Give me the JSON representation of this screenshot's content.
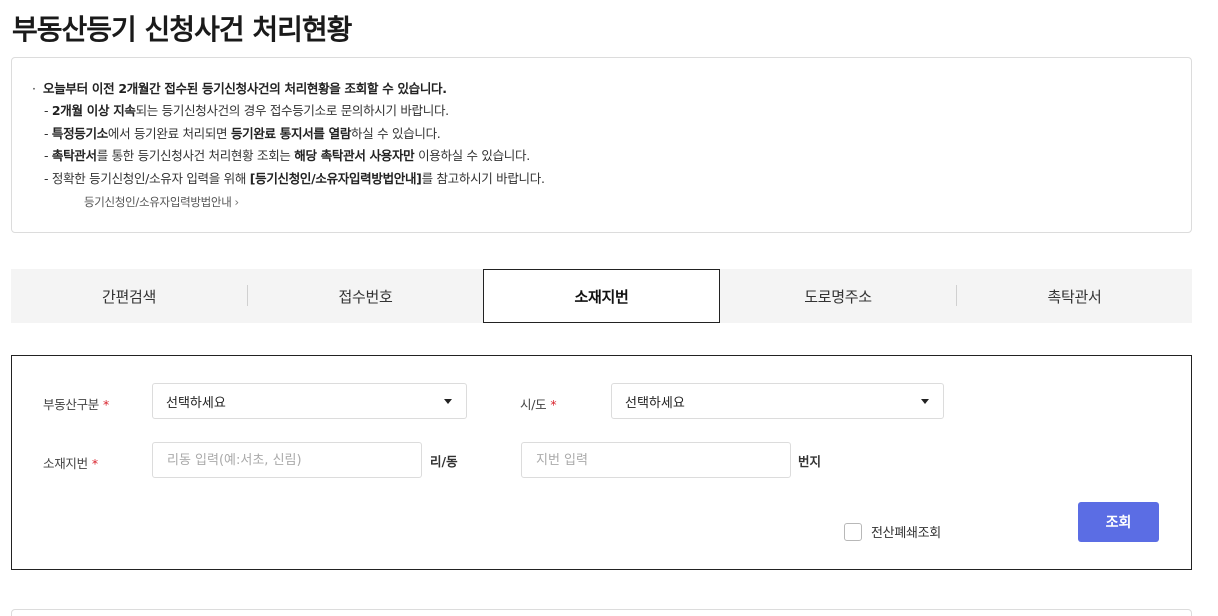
{
  "page": {
    "title": "부동산등기 신청사건 처리현황"
  },
  "notice": {
    "line1_bold": "오늘부터 이전 2개월간 접수된 등기신청사건의 처리현황을 조회할 수 있습니다.",
    "line2_bold": "2개월 이상 지속",
    "line2_rest": "되는 등기신청사건의 경우 접수등기소로 문의하시기 바랍니다.",
    "line3_bold1": "특정등기소",
    "line3_mid": "에서 등기완료 처리되면 ",
    "line3_bold2": "등기완료 통지서를 열람",
    "line3_rest": "하실 수 있습니다.",
    "line4_bold1": "촉탁관서",
    "line4_mid": "를 통한 등기신청사건 처리현황 조회는 ",
    "line4_bold2": "해당 촉탁관서 사용자만",
    "line4_rest": " 이용하실 수 있습니다.",
    "line5_pre": "정확한 등기신청인/소유자 입력을 위해 ",
    "line5_bold": "[등기신청인/소유자입력방법안내]",
    "line5_rest": "를 참고하시기 바랍니다.",
    "guide_link": "등기신청인/소유자입력방법안내"
  },
  "tabs": [
    {
      "label": "간편검색",
      "active": false
    },
    {
      "label": "접수번호",
      "active": false
    },
    {
      "label": "소재지번",
      "active": true
    },
    {
      "label": "도로명주소",
      "active": false
    },
    {
      "label": "촉탁관서",
      "active": false
    }
  ],
  "form": {
    "property_type_label": "부동산구분",
    "property_type_value": "선택하세요",
    "sido_label": "시/도",
    "sido_value": "선택하세요",
    "location_label": "소재지번",
    "ri_dong_placeholder": "리동 입력(예:서초, 신림)",
    "ri_dong_unit": "리/동",
    "jibun_placeholder": "지번 입력",
    "jibun_unit": "번지",
    "required_mark": "*",
    "closed_search_label": "전산폐쇄조회",
    "closed_search_checked": false,
    "search_button": "조회"
  },
  "colors": {
    "primary_button": "#5b6de4",
    "required": "#d9232d"
  }
}
